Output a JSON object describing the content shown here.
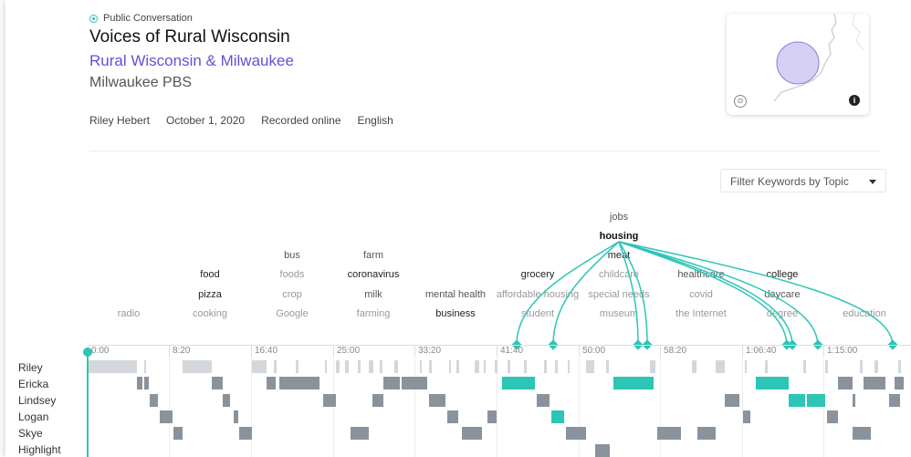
{
  "header": {
    "kicker": "Public Conversation",
    "title": "Voices of Rural Wisconsin",
    "subtitle": "Rural Wisconsin & Milwaukee",
    "org": "Milwaukee PBS"
  },
  "meta": {
    "host": "Riley Hebert",
    "date": "October 1, 2020",
    "mode": "Recorded online",
    "language": "English"
  },
  "filter": {
    "label": "Filter Keywords by Topic"
  },
  "map": {
    "colors": {
      "circle": "#c8c0f0",
      "circle_stroke": "#8a7ce0"
    }
  },
  "colors": {
    "accent": "#2cc5b6",
    "speaker_bar": "#8a939c",
    "host_bar": "#d3d7db"
  },
  "keywords": [
    {
      "label": "jobs",
      "weight": 1
    },
    {
      "label": "housing",
      "weight": 3
    },
    {
      "label": "meat",
      "weight": 2
    },
    {
      "label": "bus",
      "weight": 1
    },
    {
      "label": "farm",
      "weight": 1
    },
    {
      "label": "food",
      "weight": 2
    },
    {
      "label": "foods",
      "weight": 0
    },
    {
      "label": "coronavirus",
      "weight": 2
    },
    {
      "label": "grocery",
      "weight": 2
    },
    {
      "label": "childcare",
      "weight": 0
    },
    {
      "label": "healthcare",
      "weight": 1
    },
    {
      "label": "college",
      "weight": 2
    },
    {
      "label": "pizza",
      "weight": 2
    },
    {
      "label": "crop",
      "weight": 0
    },
    {
      "label": "milk",
      "weight": 1
    },
    {
      "label": "mental health",
      "weight": 1
    },
    {
      "label": "affordable housing",
      "weight": 0
    },
    {
      "label": "special needs",
      "weight": 0
    },
    {
      "label": "covid",
      "weight": 0
    },
    {
      "label": "daycare",
      "weight": 1
    },
    {
      "label": "radio",
      "weight": 0
    },
    {
      "label": "cooking",
      "weight": 0
    },
    {
      "label": "Google",
      "weight": 0
    },
    {
      "label": "farming",
      "weight": 0
    },
    {
      "label": "business",
      "weight": 2
    },
    {
      "label": "student",
      "weight": 0
    },
    {
      "label": "museum",
      "weight": 0
    },
    {
      "label": "the Internet",
      "weight": 0
    },
    {
      "label": "degree",
      "weight": 0
    },
    {
      "label": "education",
      "weight": 0
    }
  ],
  "timeline": {
    "ticks": [
      "0:00",
      "8:20",
      "16:40",
      "25:00",
      "33:20",
      "41:40",
      "50:00",
      "58:20",
      "1:06:40",
      "1:15:00"
    ],
    "speakers": [
      "Riley",
      "Ericka",
      "Lindsey",
      "Logan",
      "Skye",
      "Highlight"
    ]
  }
}
